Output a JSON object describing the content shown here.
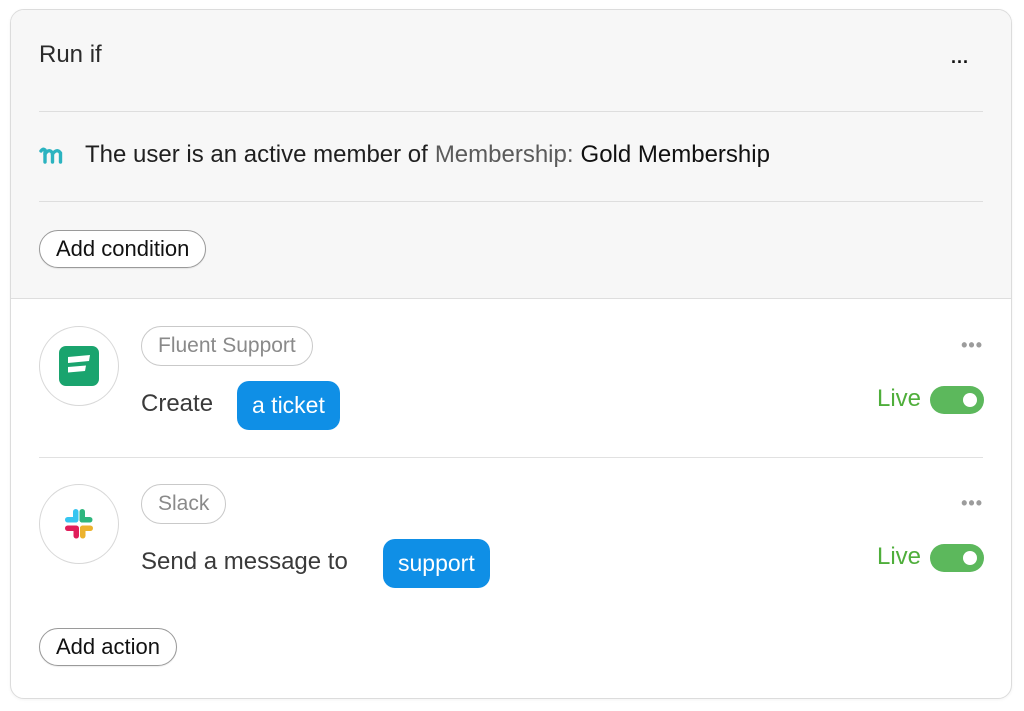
{
  "run_if": {
    "title": "Run if",
    "more_menu": "...",
    "condition": {
      "icon": "memberpress-m-icon",
      "prefix": "The user is an active member of",
      "field": "Membership:",
      "value": "Gold Membership"
    },
    "add_condition_label": "Add condition"
  },
  "actions": [
    {
      "app": "Fluent Support",
      "icon": "fluent-support-icon",
      "verb": "Create",
      "object": "a ticket",
      "status": "Live",
      "enabled": true
    },
    {
      "app": "Slack",
      "icon": "slack-icon",
      "verb": "Send a message to",
      "object": "support",
      "status": "Live",
      "enabled": true
    }
  ],
  "add_action_label": "Add action",
  "colors": {
    "accent_blue": "#0f8fe6",
    "live_green": "#4fae3b",
    "fluent_green": "#1aa46e",
    "memberpress_teal": "#2bb3c0"
  }
}
